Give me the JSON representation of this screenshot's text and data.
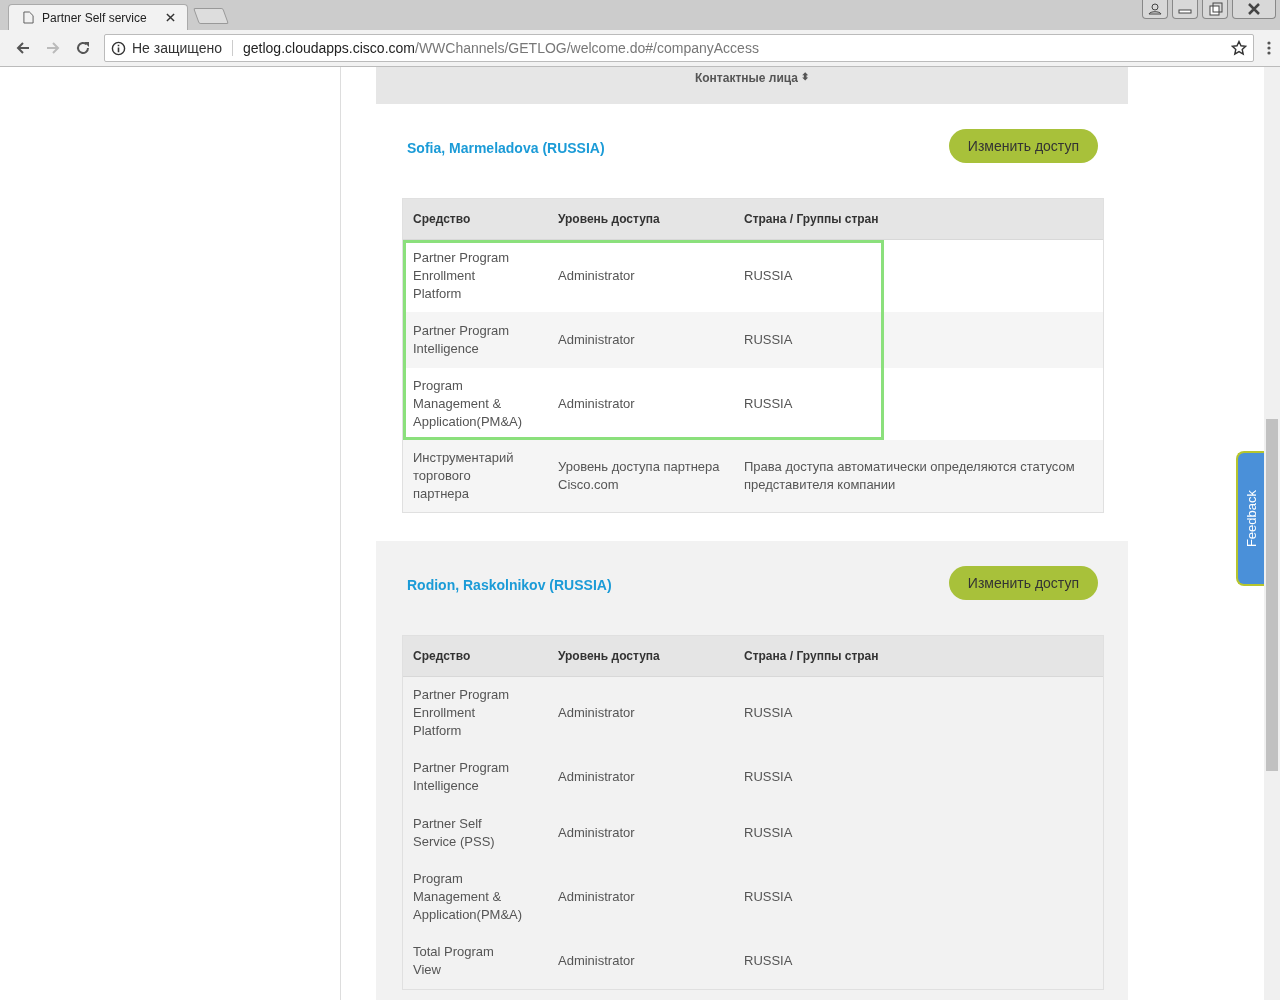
{
  "browser": {
    "tabs": [
      {
        "title": "Partner Self service",
        "selected": true
      }
    ],
    "security": "Не защищено",
    "url_host": "getlog.cloudapps.cisco.com",
    "url_path": "/WWChannels/GETLOG/welcome.do#/companyAccess"
  },
  "section_header": {
    "label": "Контактные лица",
    "sort_icon": "⬍"
  },
  "contacts": [
    {
      "name": "Sofia, Marmeladova (RUSSIA)",
      "button": "Изменить доступ",
      "shaded": false,
      "columns": [
        "Средство",
        "Уровень доступа",
        "Страна / Группы стран"
      ],
      "rows": [
        {
          "tool": "Partner Program Enrollment Platform",
          "level": "Administrator",
          "country": "RUSSIA",
          "highlighted": true
        },
        {
          "tool": "Partner Program Intelligence",
          "level": "Administrator",
          "country": "RUSSIA",
          "highlighted": true
        },
        {
          "tool": "Program Management & Application(PM&A)",
          "level": "Administrator",
          "country": "RUSSIA",
          "highlighted": true
        },
        {
          "tool": "Инструментарий торгового партнера",
          "level": "Уровень доступа партнера Cisco.com",
          "country": "Права доступа автоматически определяются статусом представителя компании",
          "highlighted": false
        }
      ]
    },
    {
      "name": "Rodion, Raskolnikov (RUSSIA)",
      "button": "Изменить доступ",
      "shaded": true,
      "columns": [
        "Средство",
        "Уровень доступа",
        "Страна / Группы стран"
      ],
      "rows": [
        {
          "tool": "Partner Program Enrollment Platform",
          "level": "Administrator",
          "country": "RUSSIA",
          "highlighted": false
        },
        {
          "tool": "Partner Program Intelligence",
          "level": "Administrator",
          "country": "RUSSIA",
          "highlighted": false
        },
        {
          "tool": "Partner Self Service (PSS)",
          "level": "Administrator",
          "country": "RUSSIA",
          "highlighted": false
        },
        {
          "tool": "Program Management & Application(PM&A)",
          "level": "Administrator",
          "country": "RUSSIA",
          "highlighted": false
        },
        {
          "tool": "Total Program View",
          "level": "Administrator",
          "country": "RUSSIA",
          "highlighted": false
        }
      ]
    }
  ],
  "feedback": "Feedback"
}
